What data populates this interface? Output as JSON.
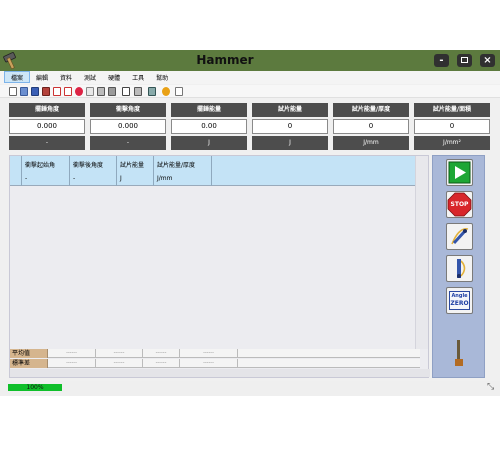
{
  "window": {
    "title": "Hammer",
    "controls": {
      "minimize": "-",
      "close": "×"
    }
  },
  "menu": [
    "檔案",
    "編輯",
    "資料",
    "測試",
    "硬體",
    "工具",
    "幫助"
  ],
  "toolbar_icons": [
    "new-file-icon",
    "open-file-icon",
    "save-icon",
    "save-as-icon",
    "export-icon",
    "pdf-icon",
    "settings-icon",
    "print-icon",
    "edit-icon",
    "lock-icon",
    "link-icon",
    "help-icon",
    "exit-icon"
  ],
  "results": [
    {
      "label": "擺錘角度",
      "value": "0.000",
      "unit": "-"
    },
    {
      "label": "衝擊角度",
      "value": "0.000",
      "unit": "-"
    },
    {
      "label": "擺錘能量",
      "value": "0.00",
      "unit": "J"
    },
    {
      "label": "試片能量",
      "value": "0",
      "unit": "J"
    },
    {
      "label": "試片能量/厚度",
      "value": "0",
      "unit": "J/mm"
    },
    {
      "label": "試片能量/面積",
      "value": "0",
      "unit": "J/mm²"
    }
  ],
  "grid": {
    "columns": [
      {
        "label": "衝擊起始角",
        "unit": "-"
      },
      {
        "label": "衝擊後角度",
        "unit": "-"
      },
      {
        "label": "試片能量",
        "unit": "J"
      },
      {
        "label": "試片能量/厚度",
        "unit": "J/mm"
      }
    ],
    "stats": [
      {
        "label": "平均值",
        "values": [
          "------",
          "------",
          "------",
          "------"
        ]
      },
      {
        "label": "標準差",
        "values": [
          "------",
          "------",
          "------",
          "------"
        ]
      }
    ]
  },
  "side_buttons": [
    "start-icon",
    "stop-icon",
    "pendulum-icon",
    "calibrate-icon",
    "angle-zero-icon"
  ],
  "angle_zero_text": {
    "line1": "Angle",
    "line2": "ZERO"
  },
  "stop_text": "STOP",
  "status": {
    "progress_text": "100%",
    "progress_fraction": 1.0
  },
  "colors": {
    "title_bar": "#5c7a3e",
    "progress": "#0fbf2a",
    "side_panel": "#a9b8d8",
    "grid_header": "#c4e3f6",
    "stat_label": "#d5b58e"
  }
}
